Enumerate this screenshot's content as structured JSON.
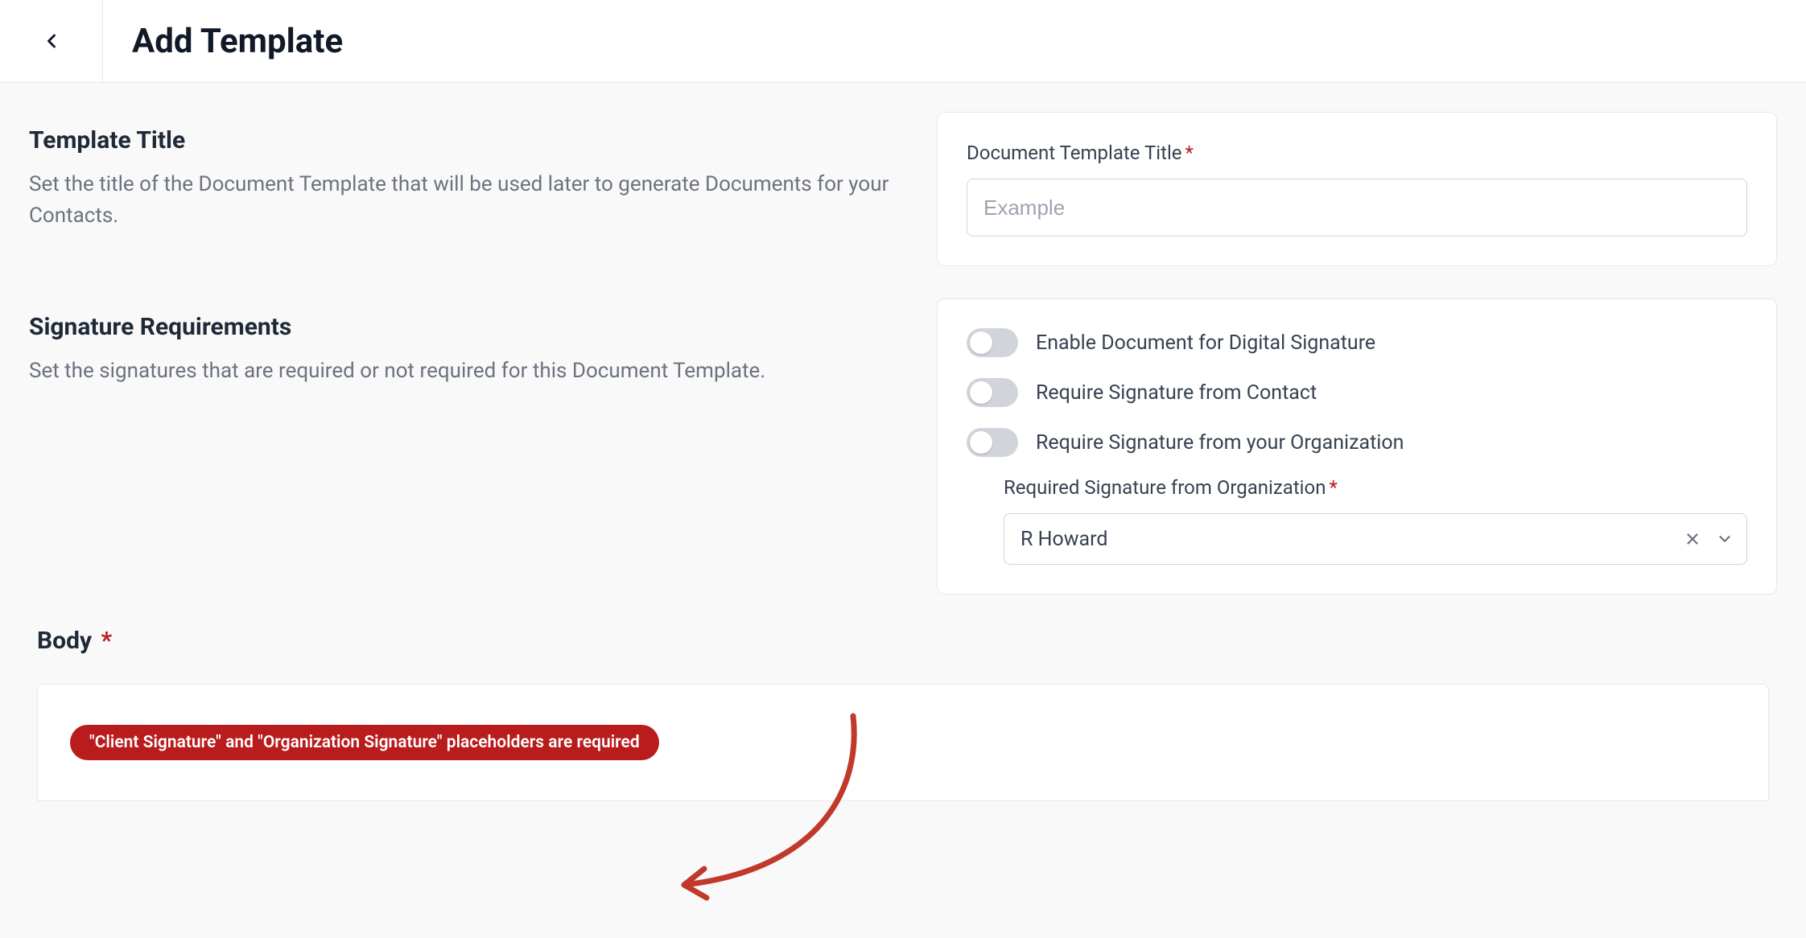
{
  "header": {
    "title": "Add Template"
  },
  "template_title": {
    "heading": "Template Title",
    "description": "Set the title of the Document Template that will be used later to generate Documents for your Contacts.",
    "field_label": "Document Template Title",
    "placeholder": "Example",
    "value": ""
  },
  "signature": {
    "heading": "Signature Requirements",
    "description": "Set the signatures that are required or not required for this Document Template.",
    "toggles": [
      {
        "label": "Enable Document for Digital Signature",
        "on": false
      },
      {
        "label": "Require Signature from Contact",
        "on": false
      },
      {
        "label": "Require Signature from your Organization",
        "on": false
      }
    ],
    "org_sig_label": "Required Signature from Organization",
    "org_sig_value": "R Howard"
  },
  "body": {
    "label": "Body",
    "error_message": "\"Client Signature\" and \"Organization Signature\" placeholders are required"
  }
}
